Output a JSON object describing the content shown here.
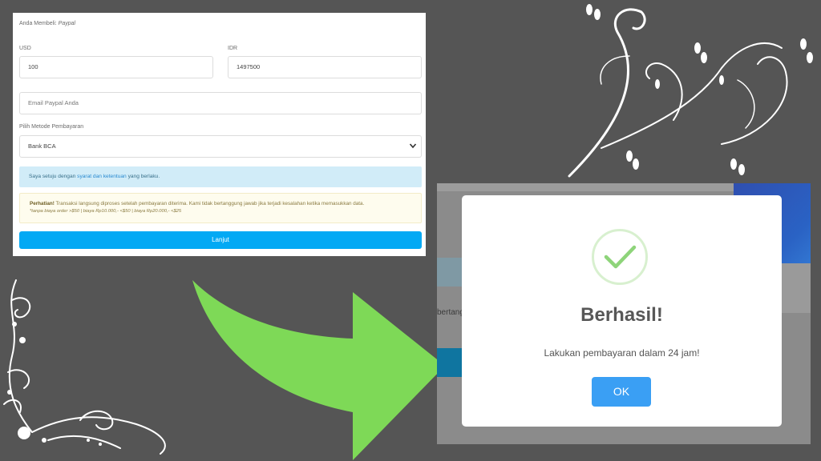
{
  "form": {
    "header_prefix": "Anda Membeli:",
    "header_product": "Paypal",
    "usd_label": "USD",
    "usd_value": "100",
    "idr_label": "IDR",
    "idr_value": "1497500",
    "email_placeholder": "Email Paypal Anda",
    "method_label": "Pilih Metode Pembayaran",
    "method_selected": "Bank BCA",
    "agree_prefix": "Saya setuju dengan",
    "agree_link": "syarat dan ketentuan",
    "agree_suffix": "yang berlaku.",
    "warning_bold": "Perhatian!",
    "warning_text": "Transaksi langsung diproses setelah pembayaran diterima. Kami tidak bertanggung jawab jika terjadi kesalahan ketika memasukkan data.",
    "warning_note": "*tanpa biaya order >$50 | biaya Rp10.000,- <$50 | biaya Rp20.000,- <$25",
    "submit_label": "Lanjut"
  },
  "background_text": "bertang",
  "modal": {
    "title": "Berhasil!",
    "message": "Lakukan pembayaran dalam 24 jam!",
    "ok_label": "OK",
    "icon": "check-icon"
  },
  "colors": {
    "background": "#555555",
    "arrow": "#7ed957",
    "primary_button": "#03a9f4",
    "ok_button": "#3a9ff4",
    "success": "#8ed47a"
  }
}
